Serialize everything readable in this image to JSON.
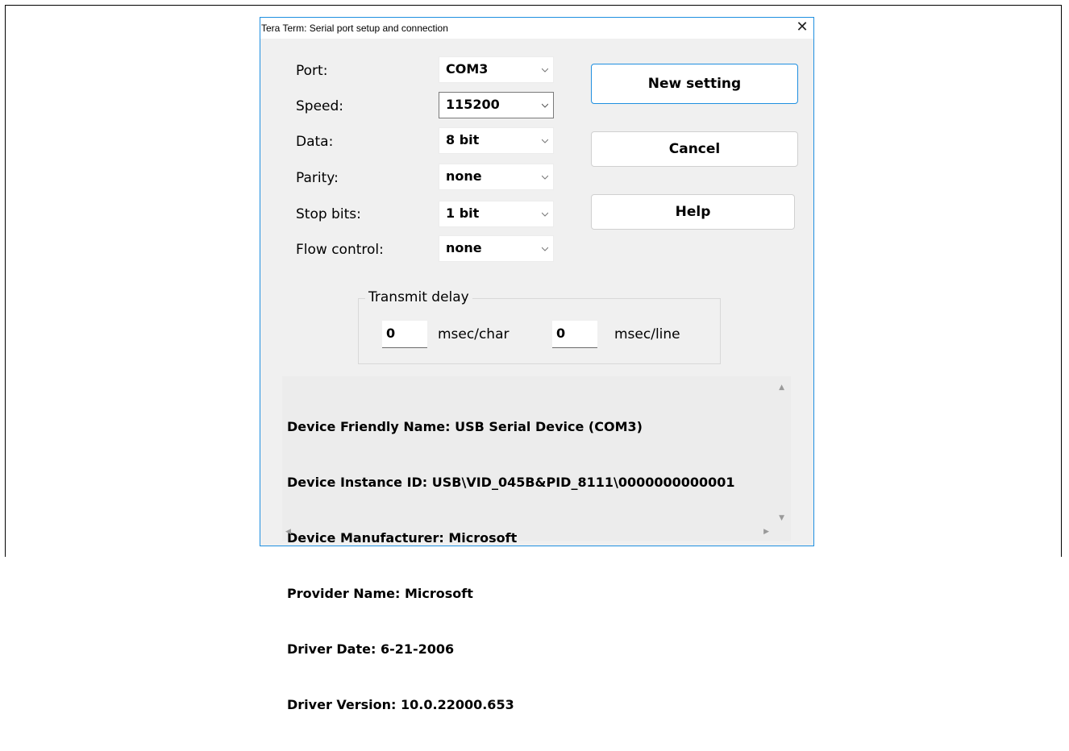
{
  "dialog": {
    "title": "Tera Term: Serial port setup and connection",
    "close_glyph": "✕"
  },
  "fields": [
    {
      "label": "Port:",
      "value": "COM3"
    },
    {
      "label": "Speed:",
      "value": "115200"
    },
    {
      "label": "Data:",
      "value": "8 bit"
    },
    {
      "label": "Parity:",
      "value": "none"
    },
    {
      "label": "Stop bits:",
      "value": "1 bit"
    },
    {
      "label": "Flow control:",
      "value": "none"
    }
  ],
  "buttons": {
    "new_setting": "New setting",
    "cancel": "Cancel",
    "help": "Help"
  },
  "transmit_delay": {
    "legend": "Transmit delay",
    "char_value": "0",
    "char_unit": "msec/char",
    "line_value": "0",
    "line_unit": "msec/line"
  },
  "device_info": {
    "lines": [
      "Device Friendly Name: USB Serial Device (COM3)",
      "Device Instance ID: USB\\VID_045B&PID_8111\\0000000000001",
      "Device Manufacturer: Microsoft",
      "Provider Name: Microsoft",
      "Driver Date: 6-21-2006",
      "Driver Version: 10.0.22000.653"
    ]
  },
  "icons": {
    "scroll_up": "▲",
    "scroll_down": "▼",
    "scroll_left": "◀",
    "scroll_right": "▶"
  },
  "colors": {
    "accent": "#1f8fe0",
    "dialog_bg": "#f0f0f0"
  }
}
